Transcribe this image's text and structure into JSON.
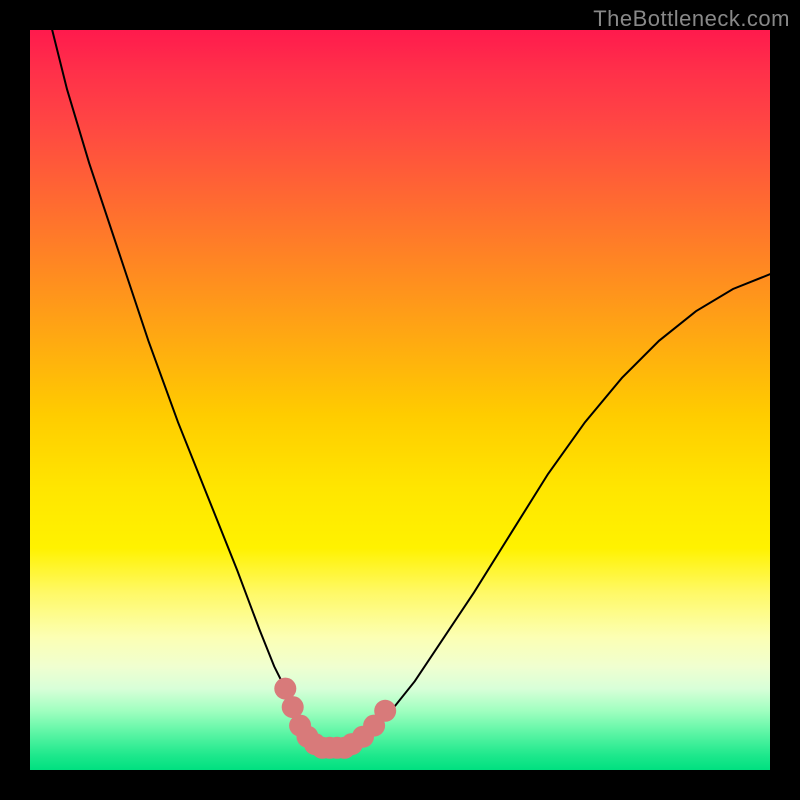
{
  "watermark": "TheBottleneck.com",
  "chart_data": {
    "type": "line",
    "title": "",
    "xlabel": "",
    "ylabel": "",
    "xlim": [
      0,
      100
    ],
    "ylim": [
      0,
      100
    ],
    "series": [
      {
        "name": "bottleneck-curve",
        "x": [
          3,
          5,
          8,
          12,
          16,
          20,
          24,
          28,
          31,
          33,
          35,
          36,
          37,
          38,
          39,
          40,
          41,
          42,
          43,
          44,
          45,
          46,
          48,
          52,
          56,
          60,
          65,
          70,
          75,
          80,
          85,
          90,
          95,
          100
        ],
        "y": [
          100,
          92,
          82,
          70,
          58,
          47,
          37,
          27,
          19,
          14,
          10,
          8,
          6,
          4,
          3,
          3,
          3,
          3,
          3,
          3,
          4,
          5,
          7,
          12,
          18,
          24,
          32,
          40,
          47,
          53,
          58,
          62,
          65,
          67
        ]
      }
    ],
    "markers": {
      "name": "bottom-dots",
      "color": "#d87a7a",
      "points": [
        {
          "x": 34.5,
          "y": 11
        },
        {
          "x": 35.5,
          "y": 8.5
        },
        {
          "x": 36.5,
          "y": 6
        },
        {
          "x": 37.5,
          "y": 4.5
        },
        {
          "x": 38.5,
          "y": 3.5
        },
        {
          "x": 39.5,
          "y": 3
        },
        {
          "x": 40.5,
          "y": 3
        },
        {
          "x": 41.5,
          "y": 3
        },
        {
          "x": 42.5,
          "y": 3
        },
        {
          "x": 43.5,
          "y": 3.5
        },
        {
          "x": 45,
          "y": 4.5
        },
        {
          "x": 46.5,
          "y": 6
        },
        {
          "x": 48,
          "y": 8
        }
      ]
    },
    "gradient_stops": [
      {
        "pos": 0,
        "color": "#ff1a4d"
      },
      {
        "pos": 50,
        "color": "#ffcc00"
      },
      {
        "pos": 85,
        "color": "#f0ffd0"
      },
      {
        "pos": 100,
        "color": "#00e080"
      }
    ]
  }
}
